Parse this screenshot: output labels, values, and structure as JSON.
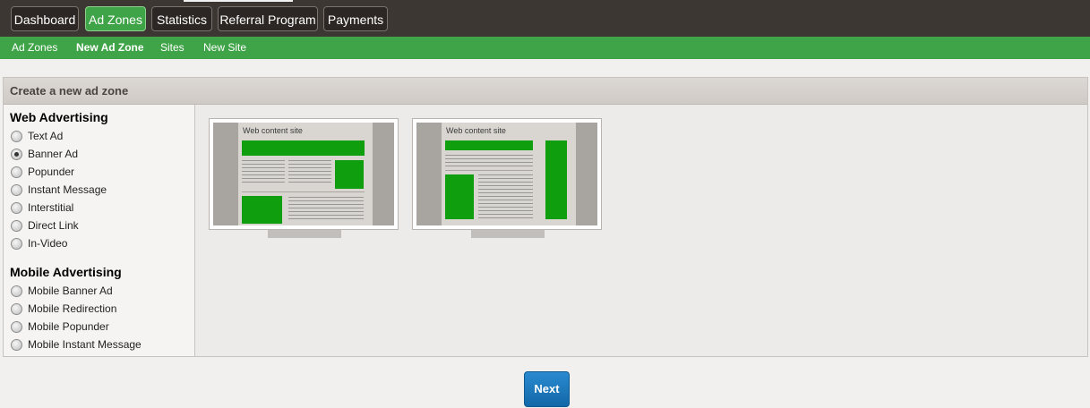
{
  "top_nav": {
    "items": [
      {
        "label": "Dashboard",
        "active": false
      },
      {
        "label": "Ad Zones",
        "active": true
      },
      {
        "label": "Statistics",
        "active": false
      },
      {
        "label": "Referral Program",
        "active": false
      },
      {
        "label": "Payments",
        "active": false
      }
    ]
  },
  "sub_nav": {
    "items": [
      {
        "label": "Ad Zones",
        "active": false
      },
      {
        "label": "New Ad Zone",
        "active": true
      },
      {
        "label": "Sites",
        "active": false
      },
      {
        "label": "New Site",
        "active": false
      }
    ]
  },
  "panel": {
    "title": "Create a new ad zone"
  },
  "sidebar": {
    "groups": [
      {
        "title": "Web Advertising",
        "options": [
          {
            "label": "Text Ad",
            "checked": false
          },
          {
            "label": "Banner Ad",
            "checked": true
          },
          {
            "label": "Popunder",
            "checked": false
          },
          {
            "label": "Instant Message",
            "checked": false
          },
          {
            "label": "Interstitial",
            "checked": false
          },
          {
            "label": "Direct Link",
            "checked": false
          },
          {
            "label": "In-Video",
            "checked": false
          }
        ]
      },
      {
        "title": "Mobile Advertising",
        "options": [
          {
            "label": "Mobile Banner Ad",
            "checked": false
          },
          {
            "label": "Mobile Redirection",
            "checked": false
          },
          {
            "label": "Mobile Popunder",
            "checked": false
          },
          {
            "label": "Mobile Instant Message",
            "checked": false
          }
        ]
      }
    ]
  },
  "thumbnails": [
    {
      "site_title": "Web content site",
      "layout": "horizontal-banner"
    },
    {
      "site_title": "Web content site",
      "layout": "vertical-banner"
    }
  ],
  "footer": {
    "next_label": "Next"
  },
  "colors": {
    "top_nav_bg": "#3d3733",
    "accent_green": "#3fa447",
    "banner_green": "#0e9e0e",
    "next_blue": "#1a78bd"
  }
}
